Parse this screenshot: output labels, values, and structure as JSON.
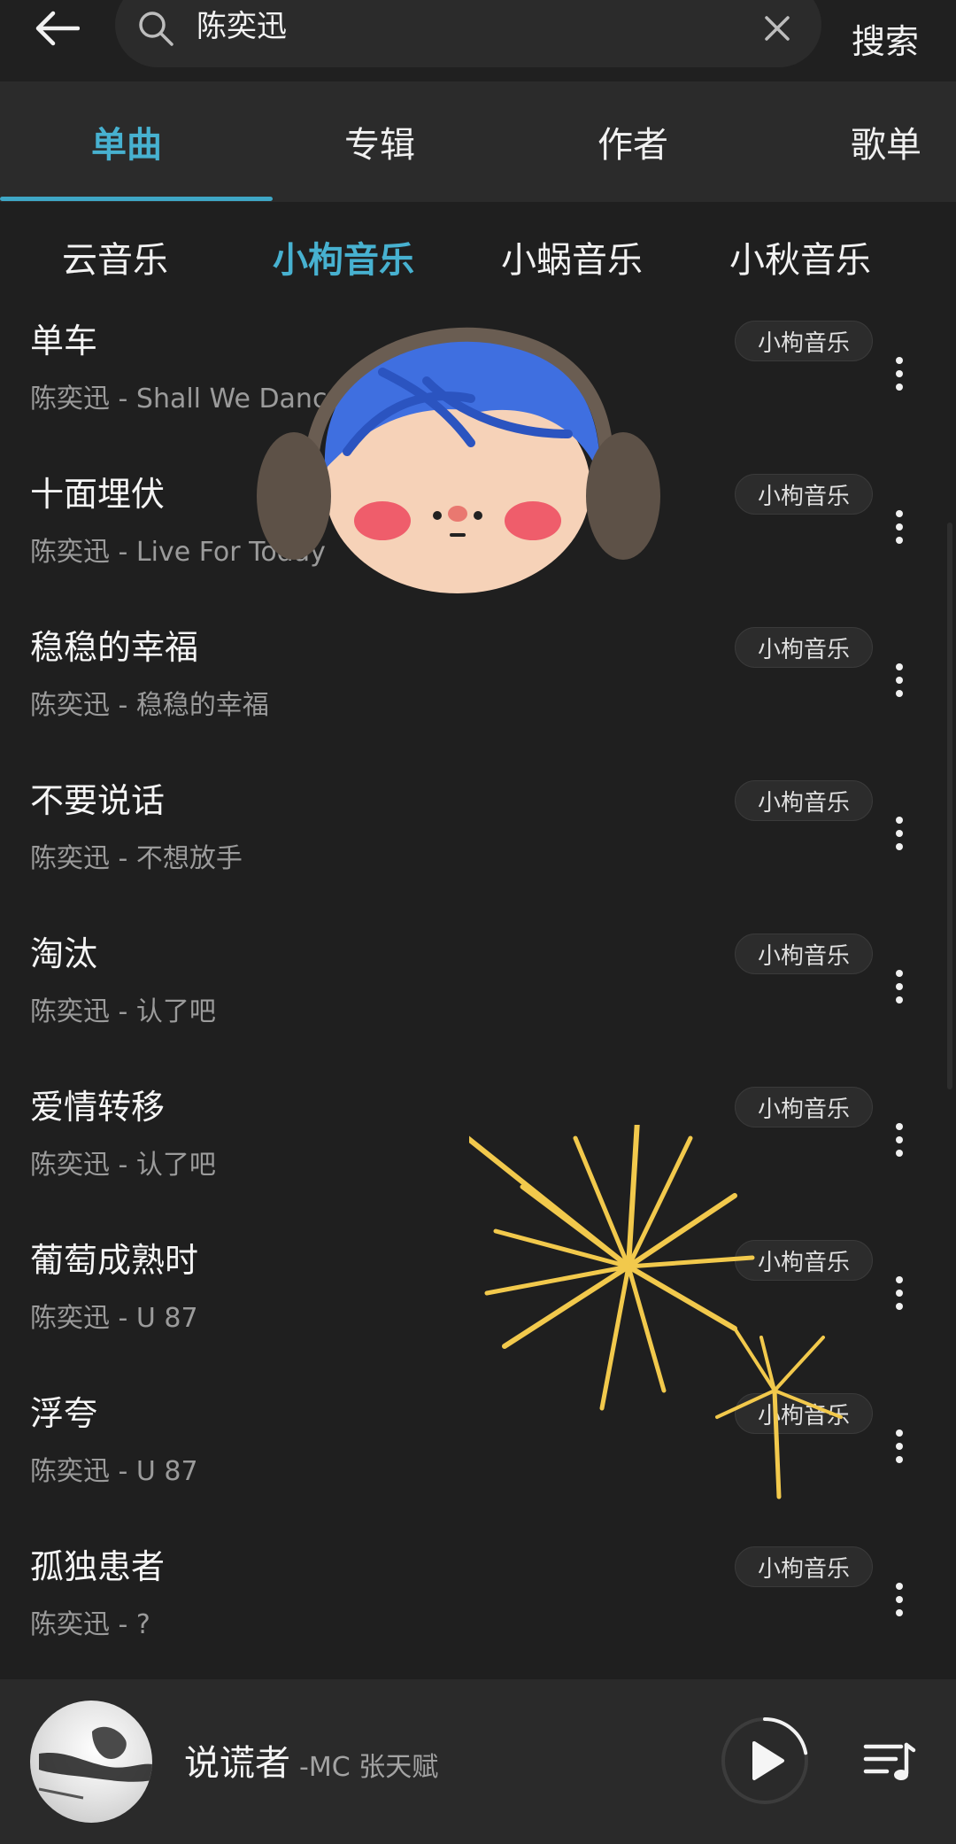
{
  "search": {
    "query": "陈奕迅",
    "button_label": "搜索"
  },
  "tabs": [
    {
      "label": "单曲",
      "active": true
    },
    {
      "label": "专辑",
      "active": false
    },
    {
      "label": "作者",
      "active": false
    },
    {
      "label": "歌单",
      "active": false
    }
  ],
  "sources": [
    {
      "label": "云音乐",
      "active": false
    },
    {
      "label": "小枸音乐",
      "active": true
    },
    {
      "label": "小蜗音乐",
      "active": false
    },
    {
      "label": "小秋音乐",
      "active": false
    }
  ],
  "songs": [
    {
      "title": "单车",
      "subtitle": "陈奕迅 - Shall We Dance",
      "source": "小枸音乐"
    },
    {
      "title": "十面埋伏",
      "subtitle": "陈奕迅 - Live For Today",
      "source": "小枸音乐"
    },
    {
      "title": "稳稳的幸福",
      "subtitle": "陈奕迅 - 稳稳的幸福",
      "source": "小枸音乐"
    },
    {
      "title": "不要说话",
      "subtitle": "陈奕迅 - 不想放手",
      "source": "小枸音乐"
    },
    {
      "title": "淘汰",
      "subtitle": "陈奕迅 - 认了吧",
      "source": "小枸音乐"
    },
    {
      "title": "爱情转移",
      "subtitle": "陈奕迅 - 认了吧",
      "source": "小枸音乐"
    },
    {
      "title": "葡萄成熟时",
      "subtitle": "陈奕迅 - U 87",
      "source": "小枸音乐"
    },
    {
      "title": "浮夸",
      "subtitle": "陈奕迅 - U 87",
      "source": "小枸音乐"
    },
    {
      "title": "孤独患者",
      "subtitle": "陈奕迅 - ?",
      "source": "小枸音乐"
    }
  ],
  "now_playing": {
    "title": "说谎者",
    "artist": "-MC 张天赋",
    "progress": 0.22
  },
  "colors": {
    "accent": "#47b1d0",
    "background": "#1f1f1f",
    "tab_bar": "#2b2b2b",
    "player_bar": "#2a2a2a",
    "subtitle": "#9b9b9b"
  },
  "icons": {
    "back": "arrow-left-icon",
    "search": "search-icon",
    "clear": "close-icon",
    "more": "more-vertical-icon",
    "play": "play-icon",
    "playlist": "playlist-icon"
  }
}
